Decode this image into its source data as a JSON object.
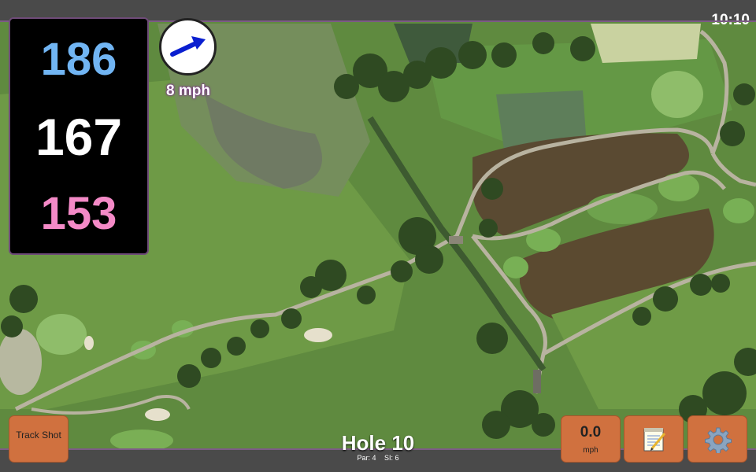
{
  "status_bar": {
    "time": "10:10"
  },
  "distances": {
    "back": "186",
    "center": "167",
    "front": "153"
  },
  "wind": {
    "speed_label": "8 mph",
    "arrow_icon": "wind-arrow-icon"
  },
  "buttons": {
    "track_shot_label": "Track Shot",
    "speed_value": "0.0",
    "speed_unit": "mph",
    "notes_icon": "notepad-icon",
    "settings_icon": "gear-icon"
  },
  "hole": {
    "title": "Hole 10",
    "par": "Par: 4",
    "si": "SI: 6"
  },
  "colors": {
    "back": "#71b5f3",
    "center": "#ffffff",
    "front": "#f48ac7",
    "button": "#d0713f",
    "bar": "#4a4a4a",
    "accent": "#7d5b86"
  }
}
